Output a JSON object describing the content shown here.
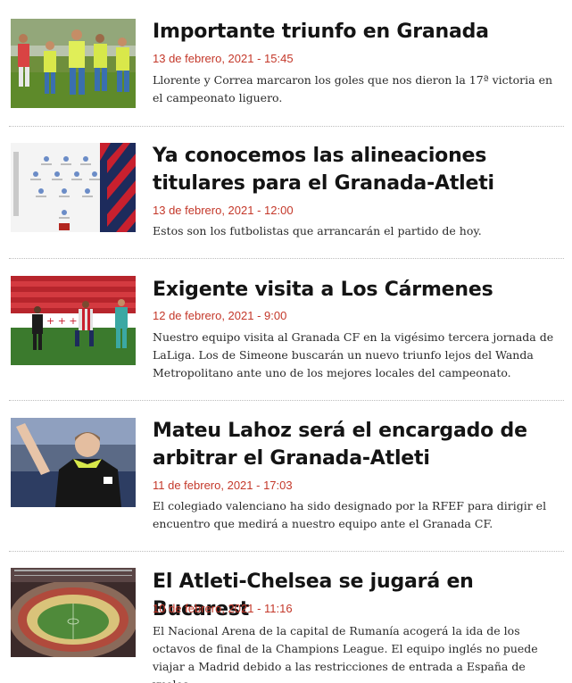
{
  "articles": [
    {
      "title": "Importante triunfo en Granada",
      "date": "13 de febrero, 2021 - 15:45",
      "excerpt": "Llorente y Correa marcaron los goles que nos dieron la 17ª victoria en el campeonato liguero.",
      "image": "players-celebrating"
    },
    {
      "title": "Ya conocemos las alineaciones titulares para el Granada-Atleti",
      "date": "13 de febrero, 2021 - 12:00",
      "excerpt": "Estos son los futbolistas que arrancarán el partido de hoy.",
      "image": "lineup-graphic"
    },
    {
      "title": "Exigente visita a Los Cármenes",
      "date": "12 de febrero, 2021 - 9:00",
      "excerpt": "Nuestro equipo visita al Granada CF en la vigésimo tercera jornada de LaLiga. Los de Simeone buscarán un nuevo triunfo lejos del Wanda Metropolitano ante uno de los mejores locales del campeonato.",
      "image": "match-action"
    },
    {
      "title": "Mateu Lahoz será el encargado de arbitrar el Granada-Atleti",
      "date": "11 de febrero, 2021 - 17:03",
      "excerpt": "El colegiado valenciano ha sido designado por la RFEF para dirigir el encuentro que medirá a nuestro equipo ante el Granada CF.",
      "image": "referee"
    },
    {
      "title": "El Atleti-Chelsea se jugará en Bucarest",
      "date": "10 de febrero, 2021 - 11:16",
      "excerpt": "El Nacional Arena de la capital de Rumanía acogerá la ida de los octavos de final de la Champions League. El equipo inglés no puede viajar a Madrid debido a las restricciones de entrada a España de vuelos",
      "image": "stadium"
    }
  ],
  "colors": {
    "date": "#c4382a",
    "title": "#141414",
    "separator": "#bdbdbd"
  }
}
